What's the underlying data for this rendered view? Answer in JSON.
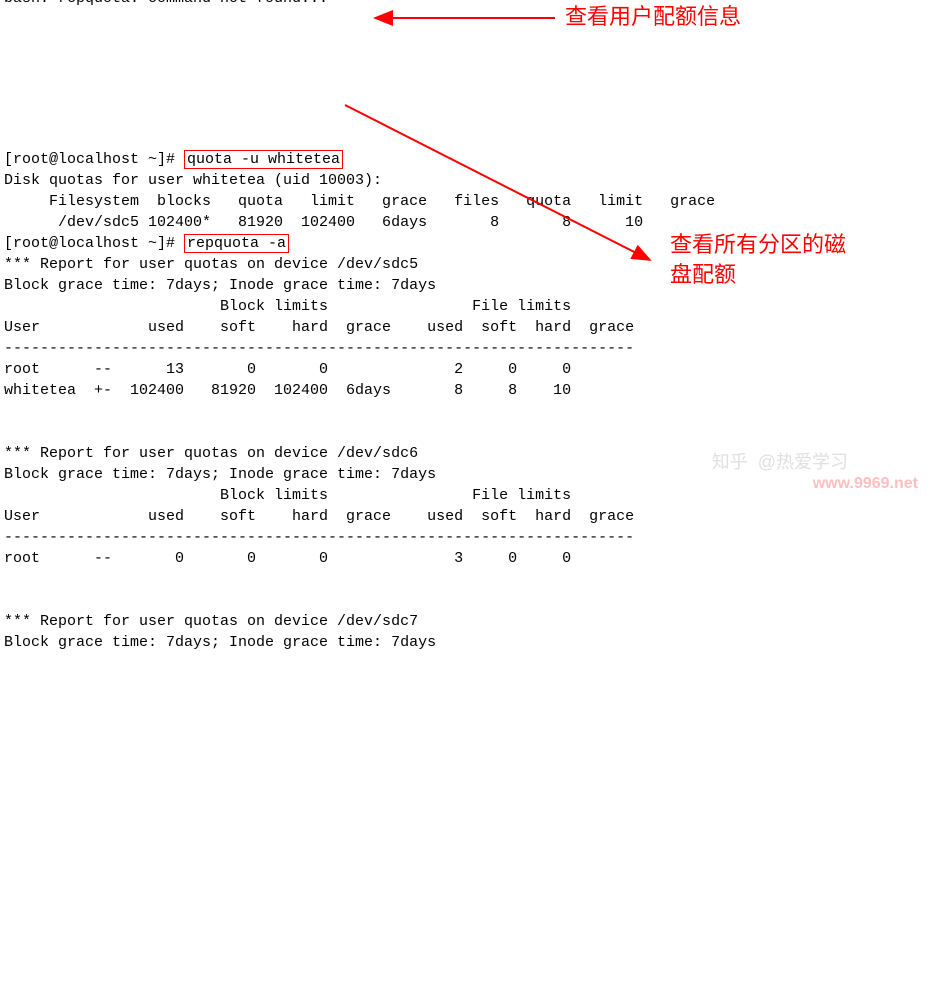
{
  "cutoff_line": "bash: repquota: command not found...",
  "line1_prefix": "[root@localhost ~]# ",
  "line1_cmd": "quota -u whitetea",
  "line2": "Disk quotas for user whitetea (uid 10003):",
  "line3": "     Filesystem  blocks   quota   limit   grace   files   quota   limit   grace",
  "line4": "      /dev/sdc5 102400*   81920  102400   6days       8       8      10        ",
  "line5_prefix": "[root@localhost ~]# ",
  "line5_cmd": "repquota -a",
  "line6": "*** Report for user quotas on device /dev/sdc5",
  "line7": "Block grace time: 7days; Inode grace time: 7days",
  "line8": "                        Block limits                File limits",
  "line9": "User            used    soft    hard  grace    used  soft  hard  grace",
  "line10": "----------------------------------------------------------------------",
  "line11": "root      --      13       0       0              2     0     0       ",
  "line12": "whitetea  +-  102400   81920  102400  6days       8     8    10       ",
  "line13": "",
  "line14": "",
  "line15": "*** Report for user quotas on device /dev/sdc6",
  "line16": "Block grace time: 7days; Inode grace time: 7days",
  "line17": "                        Block limits                File limits",
  "line18": "User            used    soft    hard  grace    used  soft  hard  grace",
  "line19": "----------------------------------------------------------------------",
  "line20": "root      --       0       0       0              3     0     0       ",
  "line21": "",
  "line22": "",
  "line23": "*** Report for user quotas on device /dev/sdc7",
  "line24": "Block grace time: 7days; Inode grace time: 7days",
  "annotation1": "查看用户配额信息",
  "annotation2": "查看所有分区的磁",
  "annotation2b": "盘配额",
  "watermark1": "知乎  @热爱学习",
  "watermark2": "www.9969.net"
}
